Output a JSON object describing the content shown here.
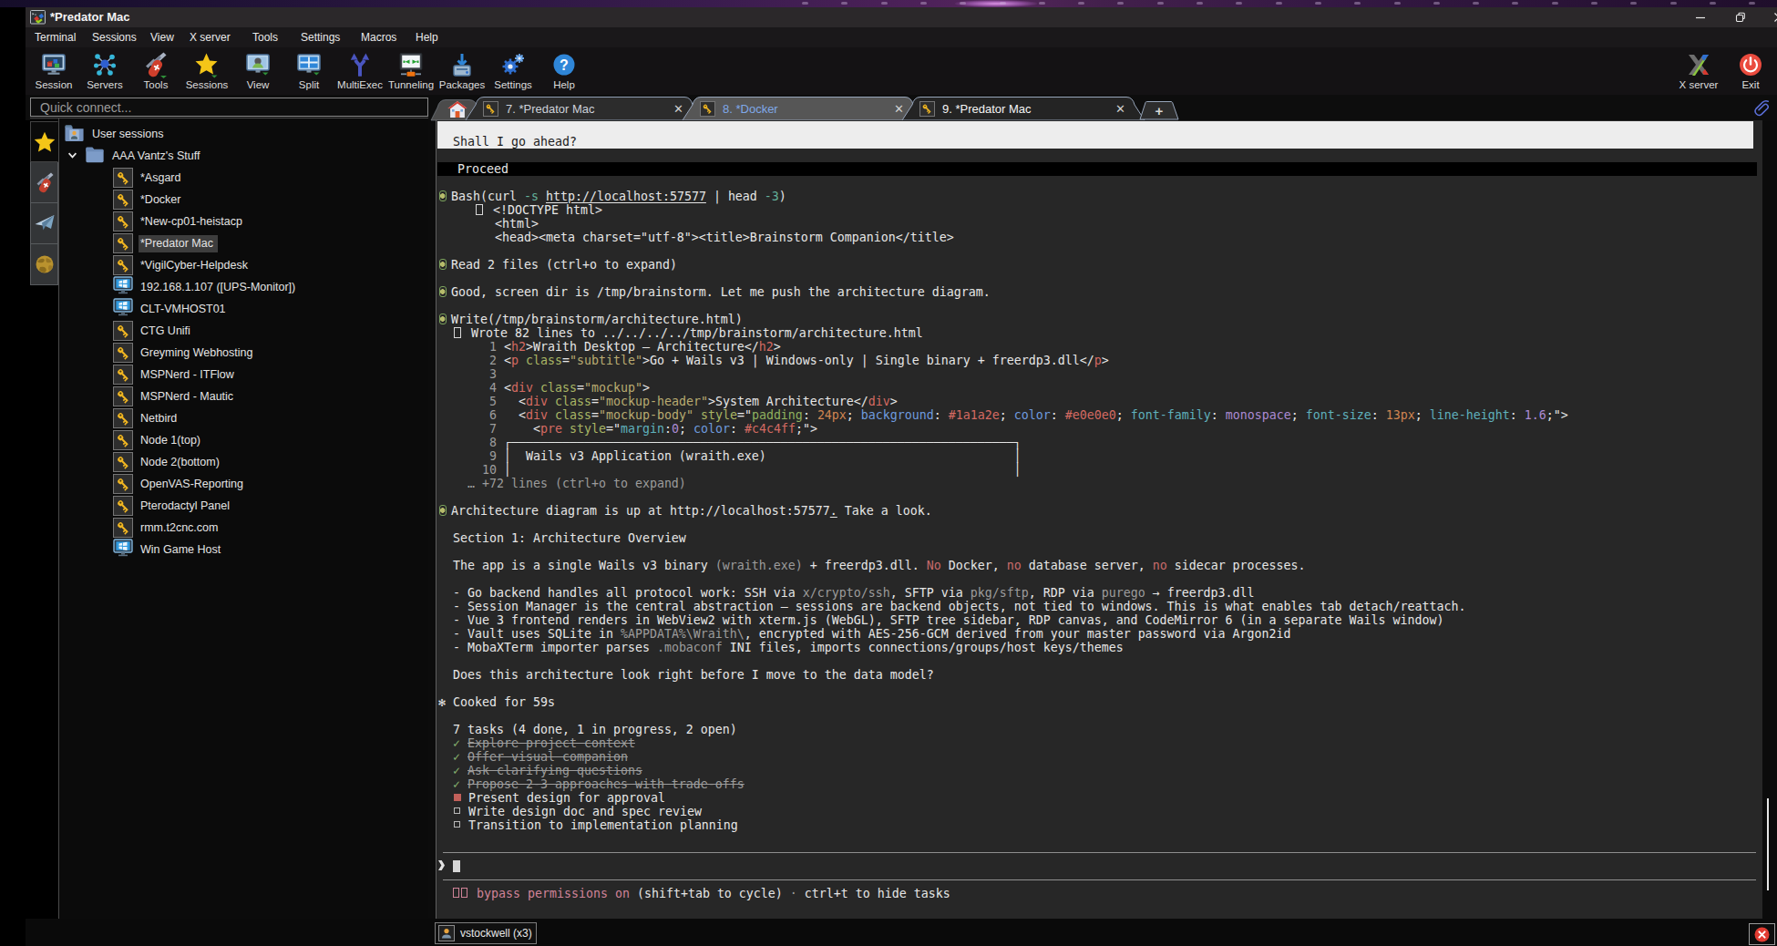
{
  "window": {
    "title": "*Predator Mac",
    "controls": {
      "minimize": "minimize",
      "restore": "restore",
      "close": "close"
    }
  },
  "menubar": {
    "items": [
      "Terminal",
      "Sessions",
      "View",
      "X server",
      "Tools",
      "Settings",
      "Macros",
      "Help"
    ]
  },
  "toolbar": {
    "items": [
      {
        "id": "session",
        "label": "Session"
      },
      {
        "id": "servers",
        "label": "Servers"
      },
      {
        "id": "tools",
        "label": "Tools"
      },
      {
        "id": "sessions",
        "label": "Sessions"
      },
      {
        "id": "view",
        "label": "View"
      },
      {
        "id": "split",
        "label": "Split"
      },
      {
        "id": "multiexec",
        "label": "MultiExec"
      },
      {
        "id": "tunneling",
        "label": "Tunneling"
      },
      {
        "id": "packages",
        "label": "Packages"
      },
      {
        "id": "settings",
        "label": "Settings"
      },
      {
        "id": "help",
        "label": "Help"
      }
    ],
    "right": [
      {
        "id": "xserver",
        "label": "X server"
      },
      {
        "id": "exit",
        "label": "Exit"
      }
    ]
  },
  "sidebar": {
    "quick_connect_placeholder": "Quick connect...",
    "rail": [
      {
        "icon": "star",
        "active": true
      },
      {
        "icon": "knife",
        "active": false
      },
      {
        "icon": "plane",
        "active": false
      },
      {
        "icon": "globe",
        "active": false
      }
    ],
    "tree": [
      {
        "icon": "user-folder",
        "label": "User sessions",
        "indent": 0
      },
      {
        "icon": "folder",
        "label": "AAA Vantz's Stuff",
        "indent": 1,
        "expanded": true
      },
      {
        "icon": "key",
        "label": "*Asgard",
        "indent": 2
      },
      {
        "icon": "key",
        "label": "*Docker",
        "indent": 2
      },
      {
        "icon": "key",
        "label": "*New-cp01-heistacp",
        "indent": 2
      },
      {
        "icon": "key",
        "label": "*Predator Mac",
        "indent": 2,
        "selected": true
      },
      {
        "icon": "key",
        "label": "*VigilCyber-Helpdesk",
        "indent": 2
      },
      {
        "icon": "monitor",
        "label": "192.168.1.107 ([UPS-Monitor])",
        "indent": 2
      },
      {
        "icon": "monitor",
        "label": "CLT-VMHOST01",
        "indent": 2
      },
      {
        "icon": "key",
        "label": "CTG Unifi",
        "indent": 2
      },
      {
        "icon": "key",
        "label": "Greyming Webhosting",
        "indent": 2
      },
      {
        "icon": "key",
        "label": "MSPNerd - ITFlow",
        "indent": 2
      },
      {
        "icon": "key",
        "label": "MSPNerd - Mautic",
        "indent": 2
      },
      {
        "icon": "key",
        "label": "Netbird",
        "indent": 2
      },
      {
        "icon": "key",
        "label": "Node 1(top)",
        "indent": 2
      },
      {
        "icon": "key",
        "label": "Node 2(bottom)",
        "indent": 2
      },
      {
        "icon": "key",
        "label": "OpenVAS-Reporting",
        "indent": 2
      },
      {
        "icon": "key",
        "label": "Pterodactyl Panel",
        "indent": 2
      },
      {
        "icon": "key",
        "label": "rmm.t2cnc.com",
        "indent": 2
      },
      {
        "icon": "monitor",
        "label": "Win Game Host",
        "indent": 2
      }
    ]
  },
  "tabbar": {
    "tabs": [
      {
        "kind": "home"
      },
      {
        "kind": "term",
        "label": "7. *Predator Mac",
        "state": "normal"
      },
      {
        "kind": "term",
        "label": "8. *Docker",
        "state": "activity"
      },
      {
        "kind": "term",
        "label": "9. *Predator Mac",
        "state": "active"
      }
    ],
    "new_tab_label": "+",
    "attach_icon": "paperclip"
  },
  "terminal": {
    "rows": [
      {
        "bg": "inv"
      },
      {
        "seg": [
          [
            "k",
            "  Shall I go ahead?"
          ]
        ],
        "bg": "inv"
      },
      {},
      {
        "seg": [
          [
            "w",
            "  Proceed"
          ]
        ],
        "bg": "bar",
        "pl": 5
      },
      {},
      {
        "seg": [
          [
            "B",
            ""
          ],
          [
            "w",
            "Bash(curl "
          ],
          [
            "t",
            "-s"
          ],
          [
            "w",
            " "
          ],
          [
            "u",
            "http://localhost:57577"
          ],
          [
            "w",
            " | head "
          ],
          [
            "t",
            "-3"
          ],
          [
            "w",
            ")"
          ]
        ]
      },
      {
        "seg": [
          [
            "w",
            "     "
          ],
          [
            "N",
            ""
          ],
          [
            "w",
            " <!DOCTYPE html>"
          ]
        ]
      },
      {
        "seg": [
          [
            "w",
            "       <html>"
          ]
        ],
        "pl": 6
      },
      {
        "seg": [
          [
            "w",
            "       <head><meta charset=\"utf-8\"><title>Brainstorm Companion</title>"
          ]
        ],
        "pl": 6
      },
      {},
      {
        "seg": [
          [
            "B",
            ""
          ],
          [
            "w",
            "Read 2 files (ctrl+o to expand)"
          ]
        ]
      },
      {},
      {
        "seg": [
          [
            "B",
            ""
          ],
          [
            "w",
            "Good, screen dir is /tmp/brainstorm. Let me push the architecture diagram."
          ]
        ]
      },
      {},
      {
        "seg": [
          [
            "B",
            ""
          ],
          [
            "w",
            "Write(/tmp/brainstorm/architecture.html)"
          ]
        ]
      },
      {
        "seg": [
          [
            "w",
            "  "
          ],
          [
            "N",
            ""
          ],
          [
            "w",
            " Wrote 82 lines to ../../../../tmp/brainstorm/architecture.html"
          ]
        ]
      },
      {
        "seg": [
          [
            "d",
            "       1 "
          ],
          [
            "w",
            "<"
          ],
          [
            "tg",
            "h2"
          ],
          [
            "w",
            ">Wraith Desktop — Architecture</"
          ],
          [
            "tg",
            "h2"
          ],
          [
            "w",
            ">"
          ]
        ]
      },
      {
        "seg": [
          [
            "d",
            "       2 "
          ],
          [
            "w",
            "<"
          ],
          [
            "tg",
            "p"
          ],
          [
            "w",
            " "
          ],
          [
            "at",
            "class"
          ],
          [
            "w",
            "="
          ],
          [
            "st",
            "\"subtitle\""
          ],
          [
            "w",
            ">Go + Wails v3 | Windows-only | Single binary + freerdp3.dll</"
          ],
          [
            "tg",
            "p"
          ],
          [
            "w",
            ">"
          ]
        ]
      },
      {
        "seg": [
          [
            "d",
            "       3"
          ]
        ]
      },
      {
        "seg": [
          [
            "d",
            "       4 "
          ],
          [
            "w",
            "<"
          ],
          [
            "tg",
            "div"
          ],
          [
            "w",
            " "
          ],
          [
            "at",
            "class"
          ],
          [
            "w",
            "="
          ],
          [
            "st",
            "\"mockup\""
          ],
          [
            "w",
            ">"
          ]
        ]
      },
      {
        "seg": [
          [
            "d",
            "       5 "
          ],
          [
            "w",
            "  <"
          ],
          [
            "tg",
            "div"
          ],
          [
            "w",
            " "
          ],
          [
            "at",
            "class"
          ],
          [
            "w",
            "="
          ],
          [
            "st",
            "\"mockup-header\""
          ],
          [
            "w",
            ">System Architecture</"
          ],
          [
            "tg",
            "div"
          ],
          [
            "w",
            ">"
          ]
        ]
      },
      {
        "seg": [
          [
            "d",
            "       6 "
          ],
          [
            "w",
            "  <"
          ],
          [
            "tg",
            "div"
          ],
          [
            "w",
            " "
          ],
          [
            "at",
            "class"
          ],
          [
            "w",
            "="
          ],
          [
            "st",
            "\"mockup-body\""
          ],
          [
            "w",
            " "
          ],
          [
            "at",
            "style"
          ],
          [
            "w",
            "=\""
          ],
          [
            "cg",
            "padding"
          ],
          [
            "w",
            ": "
          ],
          [
            "nm",
            "24px"
          ],
          [
            "w",
            "; "
          ],
          [
            "bl",
            "background"
          ],
          [
            "w",
            ": "
          ],
          [
            "tg",
            "#1a1a2e"
          ],
          [
            "w",
            "; "
          ],
          [
            "bl",
            "color"
          ],
          [
            "w",
            ": "
          ],
          [
            "tg",
            "#e0e0e0"
          ],
          [
            "w",
            "; "
          ],
          [
            "cp",
            "font-family"
          ],
          [
            "w",
            ": "
          ],
          [
            "pu",
            "monospace"
          ],
          [
            "w",
            "; "
          ],
          [
            "cp",
            "font-size"
          ],
          [
            "w",
            ": "
          ],
          [
            "nm",
            "13px"
          ],
          [
            "w",
            "; "
          ],
          [
            "cp",
            "line-height"
          ],
          [
            "w",
            ": "
          ],
          [
            "pu",
            "1.6"
          ],
          [
            "w",
            ";\">"
          ]
        ]
      },
      {
        "seg": [
          [
            "d",
            "       7 "
          ],
          [
            "w",
            "    <"
          ],
          [
            "tg",
            "pre"
          ],
          [
            "w",
            " "
          ],
          [
            "at",
            "style"
          ],
          [
            "w",
            "=\""
          ],
          [
            "cp",
            "margin"
          ],
          [
            "w",
            ":"
          ],
          [
            "pu",
            "0"
          ],
          [
            "w",
            "; "
          ],
          [
            "bl",
            "color"
          ],
          [
            "w",
            ": "
          ],
          [
            "tg",
            "#c4c4ff"
          ],
          [
            "w",
            ";\">"
          ]
        ]
      },
      {
        "seg": [
          [
            "d",
            "       8 "
          ],
          [
            "w",
            "┌─────────────────────────────────────────────────────────────────────┐"
          ]
        ]
      },
      {
        "seg": [
          [
            "d",
            "       9 "
          ],
          [
            "w",
            "│  Wails v3 Application (wraith.exe)                                  │"
          ]
        ]
      },
      {
        "seg": [
          [
            "d",
            "      10 "
          ],
          [
            "w",
            "│                                                                     │"
          ]
        ]
      },
      {
        "seg": [
          [
            "d",
            "    … +72 lines (ctrl+o to expand)"
          ]
        ]
      },
      {},
      {
        "seg": [
          [
            "B",
            ""
          ],
          [
            "w",
            "Architecture diagram is up at http://localhost:57577"
          ],
          [
            "u",
            "."
          ],
          [
            "w",
            " Take a look."
          ]
        ]
      },
      {},
      {
        "seg": [
          [
            "w",
            "  Section 1: Architecture Overview"
          ]
        ]
      },
      {},
      {
        "seg": [
          [
            "w",
            "  The app is a single Wails v3 binary "
          ],
          [
            "d",
            "(wraith.exe)"
          ],
          [
            "w",
            " + freerdp3.dll. "
          ],
          [
            "r",
            "No"
          ],
          [
            "w",
            " Docker, "
          ],
          [
            "r",
            "no"
          ],
          [
            "w",
            " database server, "
          ],
          [
            "r",
            "no"
          ],
          [
            "w",
            " sidecar processes."
          ]
        ]
      },
      {},
      {
        "seg": [
          [
            "w",
            "  - Go backend handles all protocol work: SSH via "
          ],
          [
            "d",
            "x/crypto/ssh"
          ],
          [
            "w",
            ", SFTP via "
          ],
          [
            "d",
            "pkg/sftp"
          ],
          [
            "w",
            ", RDP via "
          ],
          [
            "d",
            "purego"
          ],
          [
            "w",
            " → freerdp3.dll"
          ]
        ]
      },
      {
        "seg": [
          [
            "w",
            "  - Session Manager is the central abstraction — sessions are backend objects, not tied to windows. This is what enables tab detach/reattach."
          ]
        ]
      },
      {
        "seg": [
          [
            "w",
            "  - Vue 3 frontend renders in WebView2 with xterm.js (WebGL), SFTP tree sidebar, RDP canvas, and CodeMirror 6 (in a separate Wails window)"
          ]
        ]
      },
      {
        "seg": [
          [
            "w",
            "  - Vault uses SQLite in "
          ],
          [
            "d",
            "%APPDATA%\\Wraith\\"
          ],
          [
            "w",
            ", encrypted with AES-256-GCM derived from your master password via Argon2id"
          ]
        ]
      },
      {
        "seg": [
          [
            "w",
            "  - MobaXTerm importer parses "
          ],
          [
            "d",
            ".mobaconf"
          ],
          [
            "w",
            " INI files, imports connections/groups/host keys/themes"
          ]
        ]
      },
      {},
      {
        "seg": [
          [
            "w",
            "  Does this architecture look right before I move to the data model?"
          ]
        ]
      },
      {},
      {
        "seg": [
          [
            "w",
            "✻ Cooked for 59s"
          ]
        ]
      },
      {},
      {
        "seg": [
          [
            "w",
            "  7 tasks (4 done, 1 in progress, 2 open)"
          ]
        ]
      },
      {
        "seg": [
          [
            "g",
            "  ✓ "
          ],
          [
            "s",
            "Explore project context"
          ]
        ]
      },
      {
        "seg": [
          [
            "g",
            "  ✓ "
          ],
          [
            "s",
            "Offer visual companion"
          ]
        ]
      },
      {
        "seg": [
          [
            "g",
            "  ✓ "
          ],
          [
            "s",
            "Ask clarifying questions"
          ]
        ]
      },
      {
        "seg": [
          [
            "g",
            "  ✓ "
          ],
          [
            "s",
            "Propose 2-3 approaches with trade-offs"
          ]
        ]
      },
      {
        "seg": [
          [
            "w",
            "  "
          ],
          [
            "F",
            ""
          ],
          [
            "w",
            "Present design for approval"
          ]
        ]
      },
      {
        "seg": [
          [
            "w",
            "  "
          ],
          [
            "O",
            ""
          ],
          [
            "w",
            "Write design doc and spec review"
          ]
        ]
      },
      {
        "seg": [
          [
            "w",
            "  "
          ],
          [
            "O",
            ""
          ],
          [
            "w",
            "Transition to implementation planning"
          ]
        ]
      },
      {},
      {
        "typ": "hr"
      },
      {
        "seg": [
          [
            "PR",
            ""
          ],
          [
            "C",
            ""
          ]
        ]
      },
      {
        "typ": "hr"
      },
      {
        "seg": [
          [
            "w",
            "  "
          ],
          [
            "Q",
            ""
          ],
          [
            "Q",
            ""
          ],
          [
            "p",
            " bypass permissions on "
          ],
          [
            "w",
            "(shift+tab to cycle)"
          ],
          [
            "d",
            " · "
          ],
          [
            "w",
            "ctrl+t to hide tasks"
          ]
        ]
      }
    ]
  },
  "statusbar": {
    "user": "vstockwell (x3)",
    "close_icon": "close"
  },
  "colors": {
    "accent_blue_tab": "#7fa8e8",
    "terminal_bg": "#272727",
    "bullet_green": "#7ba35c",
    "task_done_green": "#8fbf7f",
    "bypass_pink": "#d08398"
  }
}
